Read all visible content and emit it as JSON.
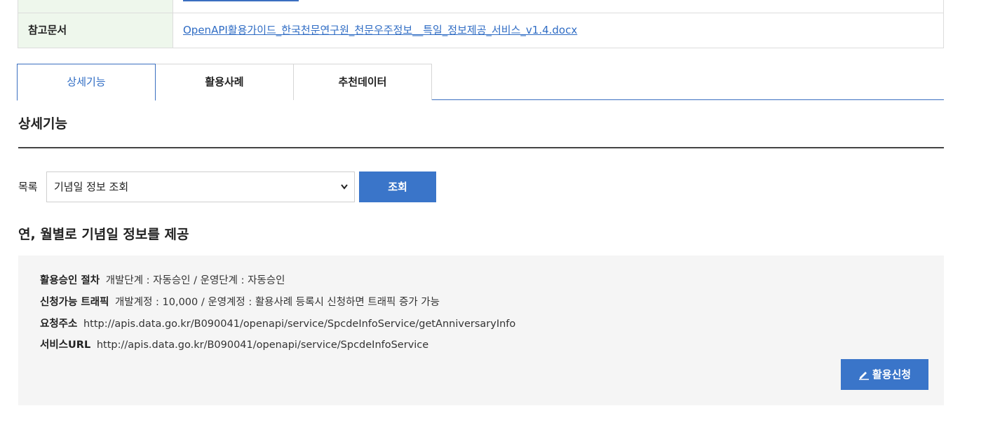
{
  "reference": {
    "label": "참고문서",
    "doc_link": "OpenAPI활용가이드_한국천문연구원_천문우주정보__특일_정보제공_서비스_v1.4.docx"
  },
  "tabs": [
    {
      "label": "상세기능",
      "active": true
    },
    {
      "label": "활용사례",
      "active": false
    },
    {
      "label": "추천데이터",
      "active": false
    }
  ],
  "section": {
    "title": "상세기능"
  },
  "list": {
    "label": "목록",
    "selected": "기념일 정보 조회",
    "query_label": "조회"
  },
  "function": {
    "title": "연, 월별로 기념일 정보를 제공",
    "approval_key": "활용승인 절차",
    "approval_value": "개발단계 : 자동승인 / 운영단계 : 자동승인",
    "traffic_key": "신청가능 트래픽",
    "traffic_value": "개발계정 : 10,000 / 운영계정 : 활용사례 등록시 신청하면 트래픽 증가 가능",
    "request_key": "요청주소",
    "request_value": "http://apis.data.go.kr/B090041/openapi/service/SpcdeInfoService/getAnniversaryInfo",
    "service_key": "서비스URL",
    "service_value": "http://apis.data.go.kr/B090041/openapi/service/SpcdeInfoService",
    "apply_label": "활용신청"
  },
  "colors": {
    "accent": "#3a75c9",
    "link": "#2f6cc4",
    "header_bg": "#eef7ec",
    "info_bg": "#f5f5f5"
  },
  "icons": {
    "select_chevron": "chevron-down-icon",
    "apply": "pencil-icon"
  }
}
